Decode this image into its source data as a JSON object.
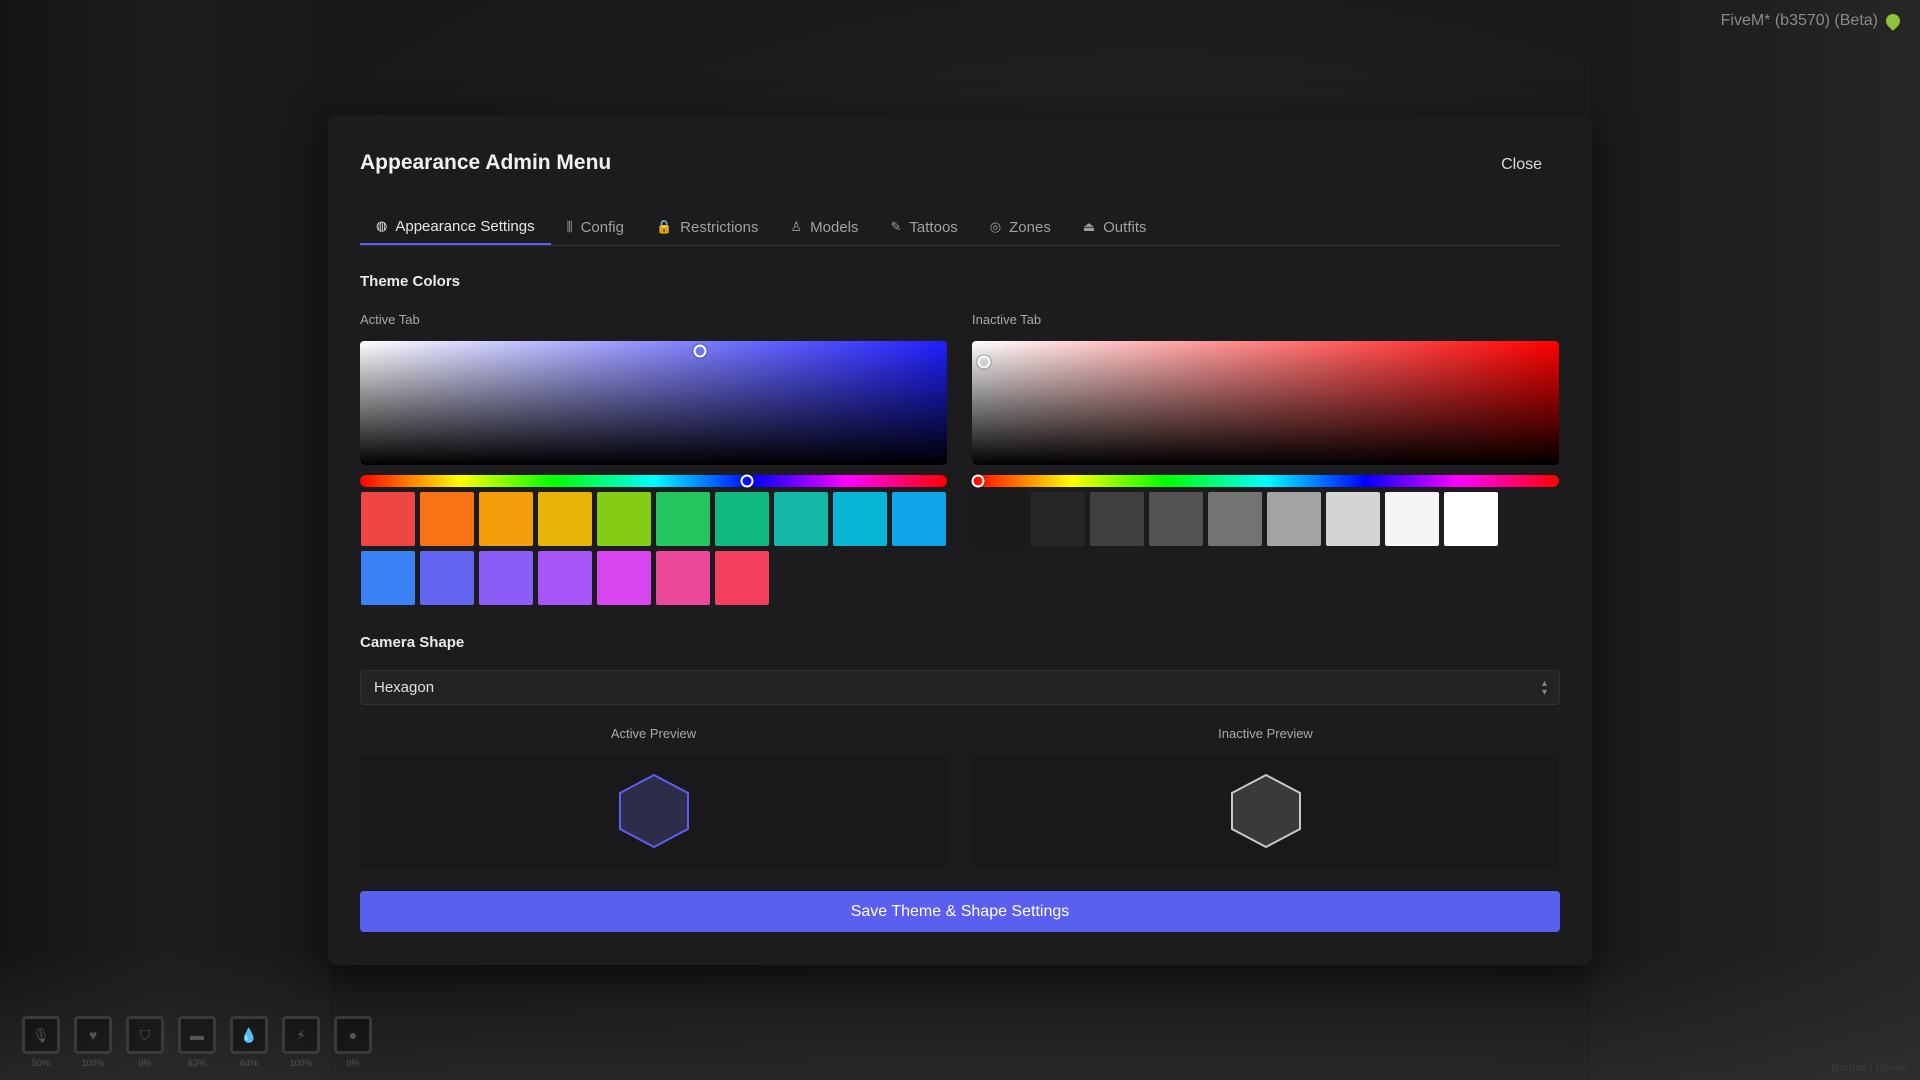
{
  "overlay": {
    "fivem_label": "FiveM* (b3570) (Beta)",
    "corner_text": "Normal | Range",
    "hud": [
      {
        "icon": "microphone-icon",
        "glyph": "🎙",
        "value": "50%"
      },
      {
        "icon": "heart-icon",
        "glyph": "♥",
        "value": "100%"
      },
      {
        "icon": "shield-icon",
        "glyph": "⛉",
        "value": "0%"
      },
      {
        "icon": "food-icon",
        "glyph": "▬",
        "value": "63%"
      },
      {
        "icon": "water-icon",
        "glyph": "💧",
        "value": "64%"
      },
      {
        "icon": "stamina-icon",
        "glyph": "⚡",
        "value": "100%"
      },
      {
        "icon": "stress-icon",
        "glyph": "●",
        "value": "0%"
      }
    ]
  },
  "modal": {
    "title": "Appearance Admin Menu",
    "close_label": "Close"
  },
  "tabs": [
    {
      "label": "Appearance Settings",
      "icon": "palette-icon",
      "glyph": "◍",
      "active": true
    },
    {
      "label": "Config",
      "icon": "sliders-icon",
      "glyph": "⫼",
      "active": false
    },
    {
      "label": "Restrictions",
      "icon": "lock-icon",
      "glyph": "🔒",
      "active": false
    },
    {
      "label": "Models",
      "icon": "user-icon",
      "glyph": "♙",
      "active": false
    },
    {
      "label": "Tattoos",
      "icon": "pen-icon",
      "glyph": "✎",
      "active": false
    },
    {
      "label": "Zones",
      "icon": "location-icon",
      "glyph": "◎",
      "active": false
    },
    {
      "label": "Outfits",
      "icon": "hanger-icon",
      "glyph": "⏏",
      "active": false
    }
  ],
  "theme": {
    "section_title": "Theme Colors",
    "active_tab": {
      "label": "Active Tab",
      "hue_color": "#1f1fff",
      "hue_fraction": 0.66,
      "saturation": 0.58,
      "value": 0.92,
      "swatches": [
        "#ef4444",
        "#f97316",
        "#f59e0b",
        "#eab308",
        "#84cc16",
        "#22c55e",
        "#10b981",
        "#14b8a6",
        "#06b6d4",
        "#0ea5e9",
        "#3b82f6",
        "#6366f1",
        "#8b5cf6",
        "#a855f7",
        "#d946ef",
        "#ec4899",
        "#f43f5e"
      ]
    },
    "inactive_tab": {
      "label": "Inactive Tab",
      "hue_color": "#ff0000",
      "hue_fraction": 0.01,
      "saturation": 0.02,
      "value": 0.83,
      "swatches": [
        "#1a1a1a",
        "#262626",
        "#404040",
        "#525252",
        "#737373",
        "#a3a3a3",
        "#d4d4d4",
        "#f5f5f5",
        "#ffffff"
      ]
    }
  },
  "camera": {
    "section_title": "Camera Shape",
    "selected": "Hexagon",
    "active_preview_label": "Active Preview",
    "inactive_preview_label": "Inactive Preview",
    "active_fill": "#2d2d4a",
    "active_stroke": "#5b5ff0",
    "inactive_fill": "#3a3a3a",
    "inactive_stroke": "#c8c8c8"
  },
  "save_label": "Save Theme & Shape Settings",
  "colors": {
    "accent": "#5b5ff0",
    "modal_bg": "#1c1c1e"
  }
}
